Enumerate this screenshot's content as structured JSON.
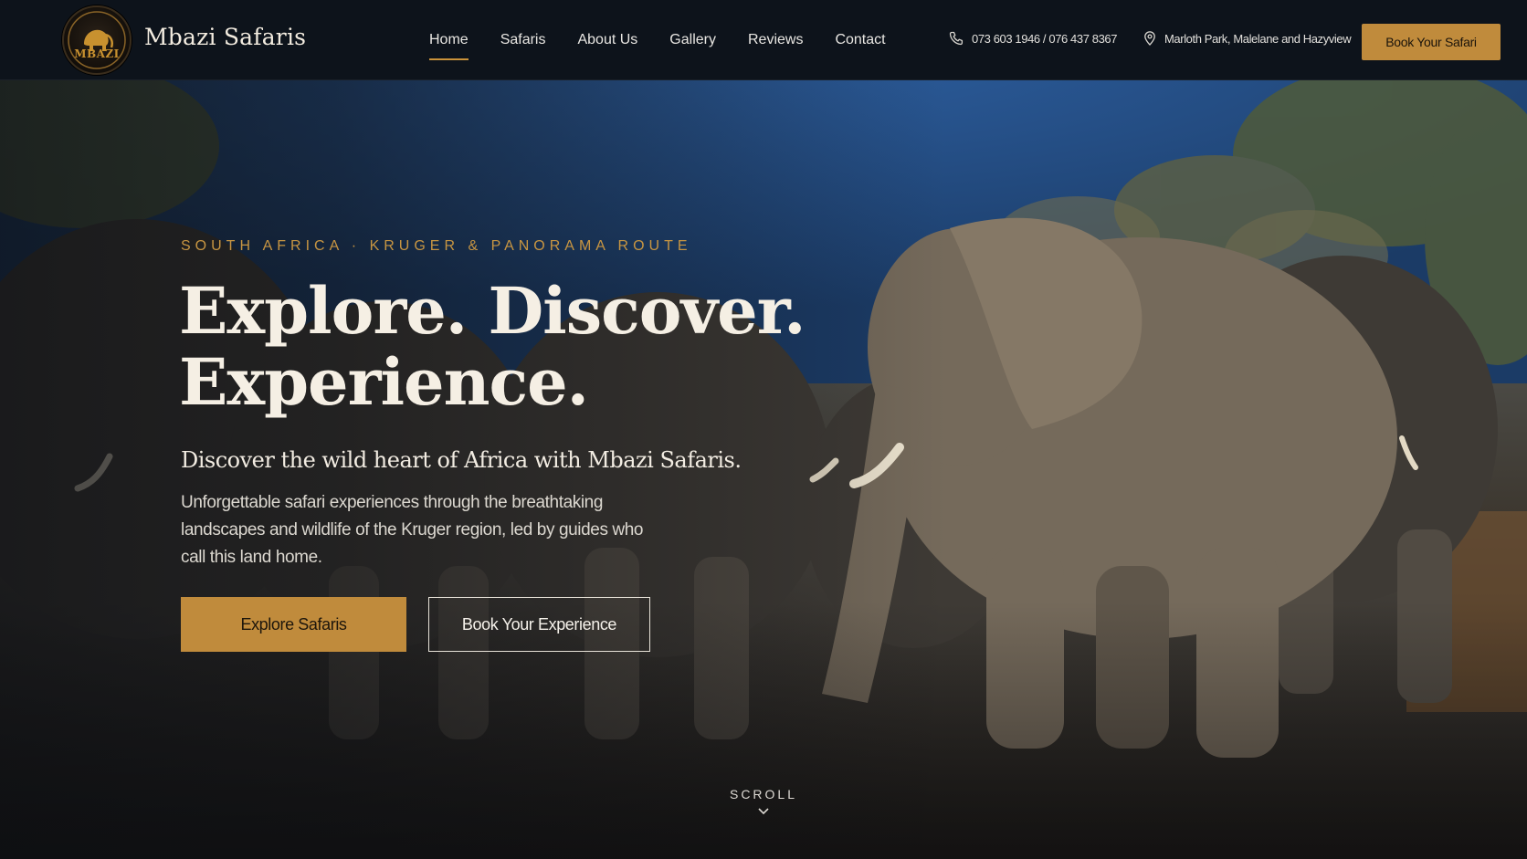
{
  "brand": {
    "logo_text": "MBAZI",
    "name": "Mbazi Safaris"
  },
  "nav": {
    "links": [
      {
        "label": "Home",
        "active": true
      },
      {
        "label": "Safaris",
        "active": false
      },
      {
        "label": "About Us",
        "active": false
      },
      {
        "label": "Gallery",
        "active": false
      },
      {
        "label": "Reviews",
        "active": false
      },
      {
        "label": "Contact",
        "active": false
      }
    ],
    "phone": "073 603 1946 / 076 437 8367",
    "location": "Marloth Park, Malelane and Hazyview",
    "book_label": "Book Your Safari"
  },
  "hero": {
    "eyebrow": "SOUTH AFRICA · KRUGER & PANORAMA ROUTE",
    "headline_line1": "Explore. Discover.",
    "headline_line2": "Experience.",
    "subhead": "Discover the wild heart of Africa with Mbazi Safaris.",
    "body": "Unforgettable safari experiences through the breathtaking landscapes and wildlife of the Kruger region, led by guides who call this land home.",
    "primary_cta": "Explore Safaris",
    "secondary_cta": "Book Your Experience",
    "scroll_label": "SCROLL"
  },
  "colors": {
    "accent_gold": "#c08b3c",
    "nav_background": "#0d131b",
    "headline_text": "#f5efe4"
  },
  "icons": {
    "phone": "phone-icon",
    "location": "map-pin-icon",
    "scroll": "chevron-down-icon"
  }
}
